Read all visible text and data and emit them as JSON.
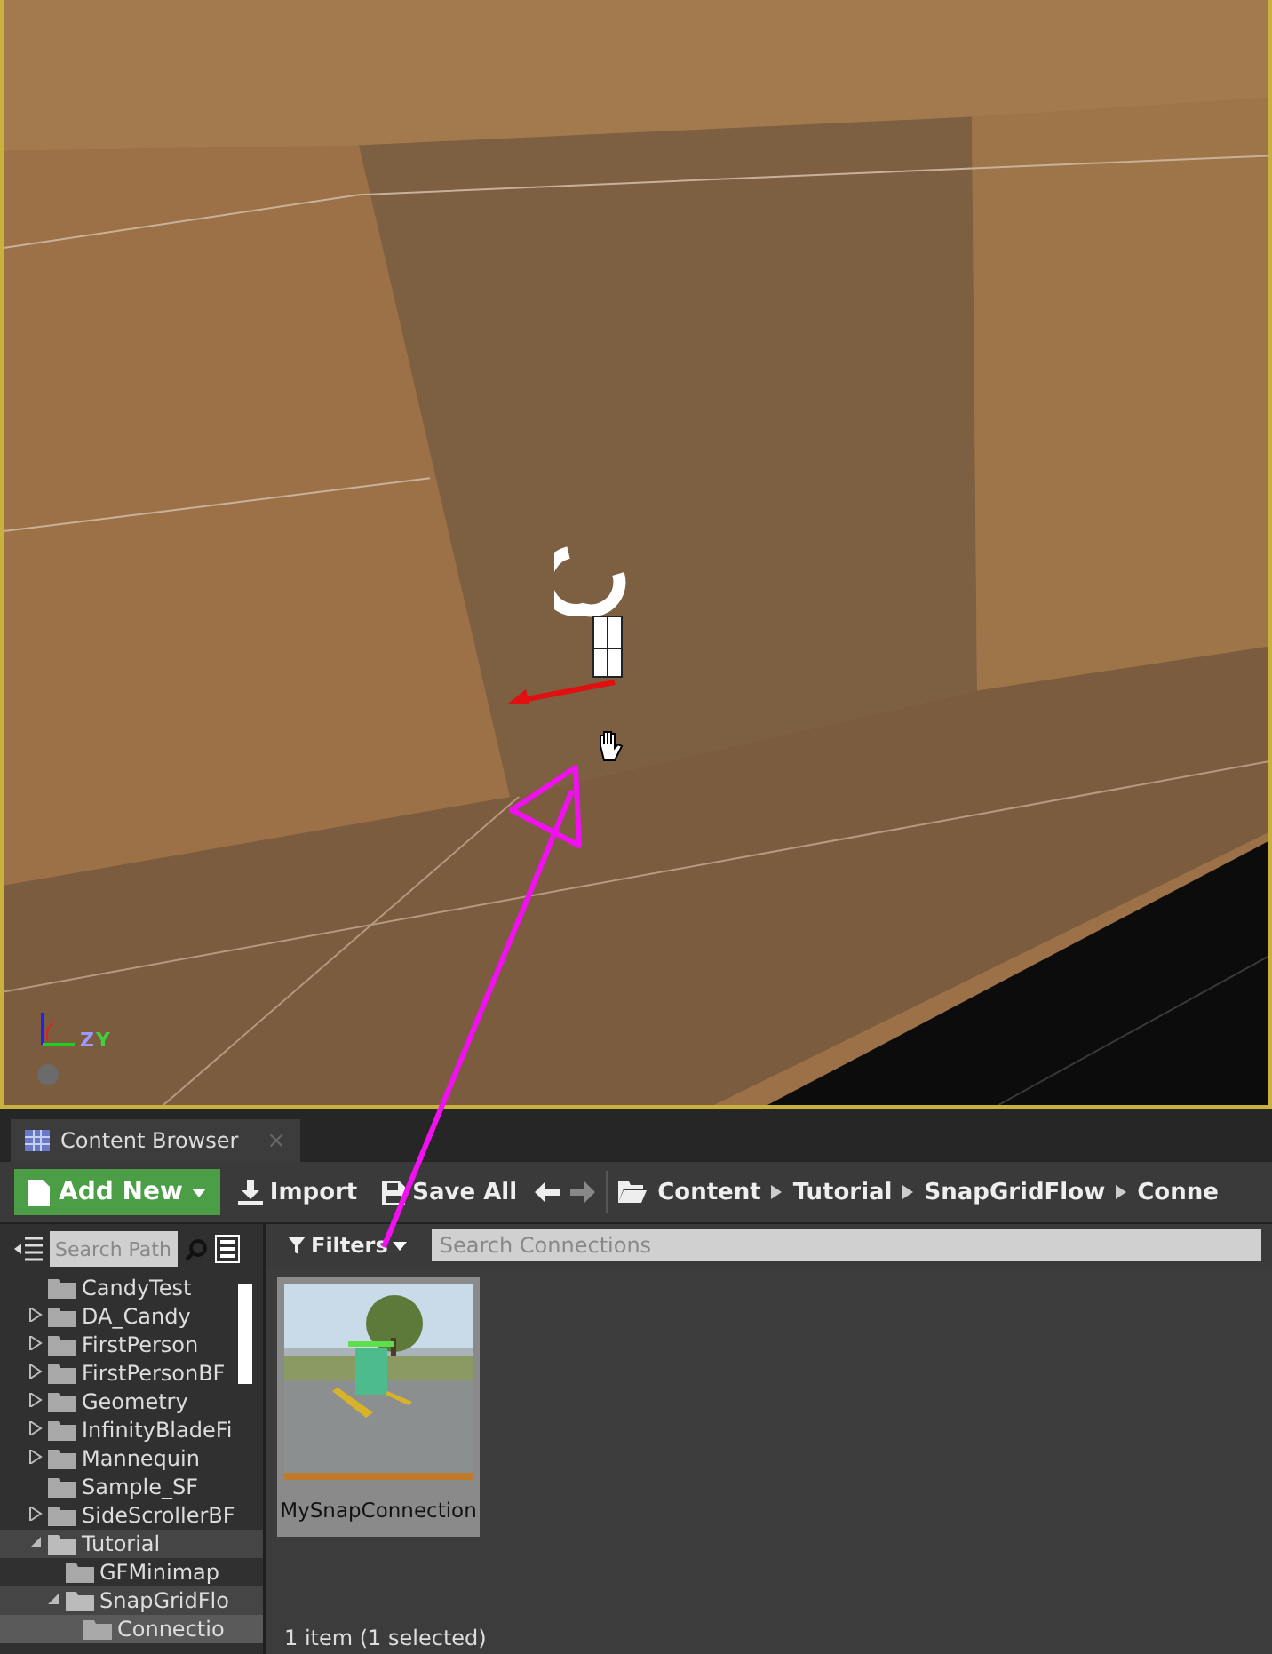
{
  "viewport": {
    "axis": {
      "z": "Z",
      "y": "Y"
    }
  },
  "content_browser": {
    "tab": {
      "label": "Content Browser",
      "close": "×"
    },
    "toolbar": {
      "add_new": "Add New",
      "import": "Import",
      "save_all": "Save All",
      "path": [
        "Content",
        "Tutorial",
        "SnapGridFlow",
        "Conne"
      ]
    },
    "search_paths": {
      "placeholder": "Search Path"
    },
    "filters": "Filters",
    "search_assets": {
      "placeholder": "Search Connections"
    },
    "tree": [
      {
        "label": "CandyTest",
        "expandable": false,
        "expanded": false,
        "selected": false
      },
      {
        "label": "DA_Candy",
        "expandable": true,
        "expanded": false,
        "selected": false
      },
      {
        "label": "FirstPerson",
        "expandable": true,
        "expanded": false,
        "selected": false
      },
      {
        "label": "FirstPersonBF",
        "expandable": true,
        "expanded": false,
        "selected": false
      },
      {
        "label": "Geometry",
        "expandable": true,
        "expanded": false,
        "selected": false
      },
      {
        "label": "InfinityBladeFi",
        "expandable": true,
        "expanded": false,
        "selected": false
      },
      {
        "label": "Mannequin",
        "expandable": true,
        "expanded": false,
        "selected": false
      },
      {
        "label": "Sample_SF",
        "expandable": false,
        "expanded": false,
        "selected": false
      },
      {
        "label": "SideScrollerBF",
        "expandable": true,
        "expanded": false,
        "selected": false
      },
      {
        "label": "Tutorial",
        "expandable": true,
        "expanded": true,
        "selected": false,
        "children": [
          {
            "label": "GFMinimap",
            "expandable": false,
            "expanded": false,
            "selected": false
          },
          {
            "label": "SnapGridFlo",
            "expandable": true,
            "expanded": true,
            "selected": false,
            "children": [
              {
                "label": "Connectio",
                "expandable": false,
                "expanded": false,
                "selected": true
              }
            ]
          }
        ]
      }
    ],
    "assets": [
      {
        "name": "MySnapConnection",
        "selected": true,
        "kind": "picture"
      }
    ],
    "status": "1 item (1 selected)"
  }
}
